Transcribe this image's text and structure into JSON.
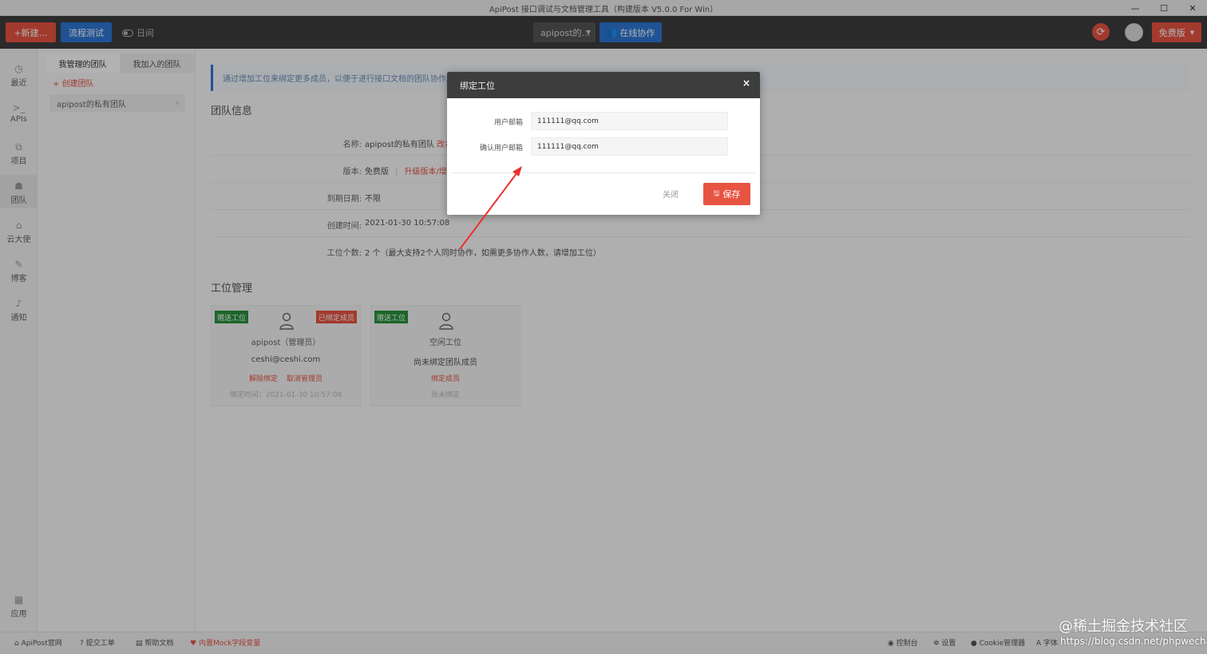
{
  "window": {
    "title": "ApiPost 接口调试与文档管理工具（构建版本 V5.0.0 For Win）"
  },
  "toolbar": {
    "new_label": "+新建…",
    "flow_label": "流程测试",
    "log_label": "日间",
    "project_label": "apipost的…",
    "collab_label": "在线协作",
    "free_label": "免费版"
  },
  "leftnav": {
    "items": [
      {
        "label": "最近",
        "icon": "clock-icon"
      },
      {
        "label": "APIs",
        "icon": "terminal-icon"
      },
      {
        "label": "项目",
        "icon": "folder-icon"
      },
      {
        "label": "团队",
        "icon": "team-icon"
      },
      {
        "label": "云大使",
        "icon": "cap-icon"
      },
      {
        "label": "博客",
        "icon": "edit-icon"
      },
      {
        "label": "通知",
        "icon": "bell-icon"
      }
    ],
    "apps_label": "应用"
  },
  "teampanel": {
    "tab_managed": "我管理的团队",
    "tab_joined": "我加入的团队",
    "create_label": "+ 创建团队",
    "team_name": "apipost的私有团队"
  },
  "main": {
    "notice": "通过增加工位来绑定更多成员，以便于进行接口文档的团队协作。",
    "team_info_title": "团队信息",
    "rows": [
      {
        "label": "名称:",
        "value": "apipost的私有团队",
        "extra": "改名"
      },
      {
        "label": "版本:",
        "value": "免费版",
        "extra": "升级版本/增"
      },
      {
        "label": "到期日期:",
        "value": "不限"
      },
      {
        "label": "创建时间:",
        "value": "2021-01-30 10:57:08"
      },
      {
        "label": "工位个数:",
        "value": "2 个（最大支持2个人同时协作，如需更多协作人数，请增加工位）"
      }
    ],
    "seat_title": "工位管理",
    "seats": [
      {
        "tag": "赠送工位",
        "status": "已绑定成员",
        "name": "apipost（管理员）",
        "email": "ceshi@ceshi.com",
        "action1": "解除绑定",
        "action2": "取消管理员",
        "time": "绑定时间：2021-01-30 10:57:08"
      },
      {
        "tag": "赠送工位",
        "name": "空闲工位",
        "email": "尚未绑定团队成员",
        "action1": "绑定成员",
        "time": "尚未绑定"
      }
    ]
  },
  "dialog": {
    "title": "绑定工位",
    "close_x": "×",
    "email_label": "用户邮箱",
    "email_value": "111111@qq.com",
    "confirm_label": "确认用户邮箱",
    "confirm_value": "111111@qq.com",
    "close_button": "关闭",
    "save_button": "保存"
  },
  "footer": {
    "site": "ApiPost官网",
    "ticket": "提交工单",
    "help": "帮助文档",
    "mock": "内置Mock字段变量",
    "console": "控制台",
    "settings": "设置",
    "cookie": "Cookie管理器",
    "font": "A 字体"
  },
  "watermark": {
    "line1": "@稀土掘金技术社区",
    "line2": "https://blog.csdn.net/phpwechat"
  },
  "colors": {
    "accent_red": "#e85442",
    "accent_blue": "#2d78d6",
    "tag_green": "#27923c",
    "toolbar_dark": "#3d3d3d"
  }
}
